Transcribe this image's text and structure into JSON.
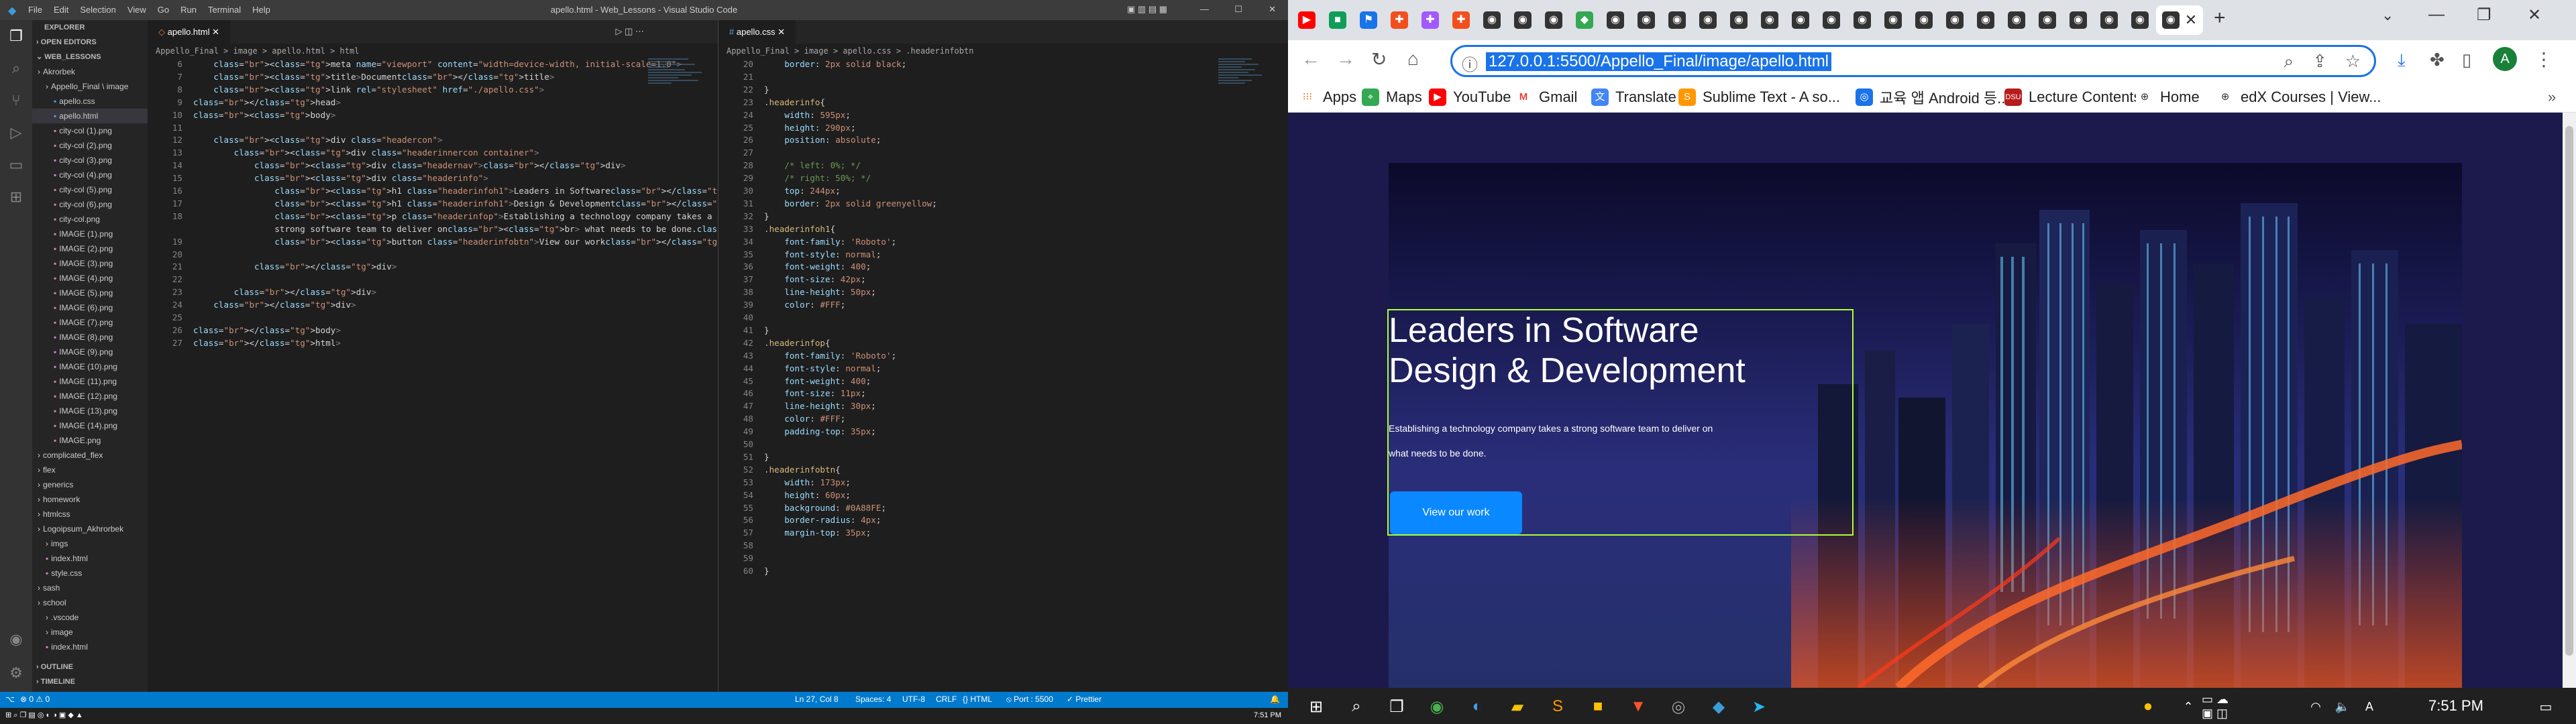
{
  "vscode": {
    "menu": [
      "File",
      "Edit",
      "Selection",
      "View",
      "Go",
      "Run",
      "Terminal",
      "Help"
    ],
    "title": "apello.html - Web_Lessons - Visual Studio Code",
    "explorer": {
      "header": "EXPLORER",
      "open_editors": "OPEN EDITORS",
      "workspace": "WEB_LESSONS",
      "items": [
        "Akrorbek",
        "Appello_Final \\ image",
        "apello.css",
        "apello.html",
        "city-col (1).png",
        "city-col (2).png",
        "city-col (3).png",
        "city-col (4).png",
        "city-col (5).png",
        "city-col (6).png",
        "city-col.png",
        "IMAGE (1).png",
        "IMAGE (2).png",
        "IMAGE (3).png",
        "IMAGE (4).png",
        "IMAGE (5).png",
        "IMAGE (6).png",
        "IMAGE (7).png",
        "IMAGE (8).png",
        "IMAGE (9).png",
        "IMAGE (10).png",
        "IMAGE (11).png",
        "IMAGE (12).png",
        "IMAGE (13).png",
        "IMAGE (14).png",
        "IMAGE.png",
        "complicated_flex",
        "flex",
        "generics",
        "homework",
        "htmlcss",
        "Logoipsum_Akhrorbek",
        "imgs",
        "index.html",
        "style.css",
        "sash",
        "school",
        ".vscode",
        "image",
        "index.html"
      ],
      "outline": "OUTLINE",
      "timeline": "TIMELINE"
    },
    "left_editor": {
      "tab": "apello.html",
      "breadcrumb": "Appello_Final > image > apello.html > html"
    },
    "right_editor": {
      "tab": "apello.css",
      "breadcrumb": "Appello_Final > image > apello.css > .headerinfobtn"
    },
    "left_lines": [
      {
        "n": "6",
        "t": "    <meta name=\"viewport\" content=\"width=device-width, initial-scale=1.0\">"
      },
      {
        "n": "7",
        "t": "    <title>Document</title>"
      },
      {
        "n": "8",
        "t": "    <link rel=\"stylesheet\" href=\"./apello.css\">"
      },
      {
        "n": "9",
        "t": "</head>"
      },
      {
        "n": "10",
        "t": "<body>"
      },
      {
        "n": "11",
        "t": ""
      },
      {
        "n": "12",
        "t": "    <div class=\"headercon\">"
      },
      {
        "n": "13",
        "t": "        <div class=\"headerinnercon container\">"
      },
      {
        "n": "14",
        "t": "            <div class=\"headernav\"></div>"
      },
      {
        "n": "15",
        "t": "            <div class=\"headerinfo\">"
      },
      {
        "n": "16",
        "t": "                <h1 class=\"headerinfoh1\">Leaders in Software</h1>"
      },
      {
        "n": "17",
        "t": "                <h1 class=\"headerinfoh1\">Design & Development</h1>"
      },
      {
        "n": "18",
        "t": "                <p class=\"headerinfop\">Establishing a technology company takes a"
      },
      {
        "n": "",
        "t": "                strong software team to deliver on<br> what needs to be done.</p>"
      },
      {
        "n": "19",
        "t": "                <button class=\"headerinfobtn\">View our work</button>"
      },
      {
        "n": "20",
        "t": ""
      },
      {
        "n": "21",
        "t": "            </div>"
      },
      {
        "n": "22",
        "t": ""
      },
      {
        "n": "23",
        "t": "        </div>"
      },
      {
        "n": "24",
        "t": "    </div>"
      },
      {
        "n": "25",
        "t": ""
      },
      {
        "n": "26",
        "t": "</body>"
      },
      {
        "n": "27",
        "t": "</html>"
      }
    ],
    "right_lines": [
      {
        "n": "20",
        "t": "    border: 2px solid black;"
      },
      {
        "n": "21",
        "t": ""
      },
      {
        "n": "22",
        "t": "}"
      },
      {
        "n": "23",
        "t": ".headerinfo{"
      },
      {
        "n": "24",
        "t": "    width: 595px;"
      },
      {
        "n": "25",
        "t": "    height: 290px;"
      },
      {
        "n": "26",
        "t": "    position: absolute;"
      },
      {
        "n": "27",
        "t": ""
      },
      {
        "n": "28",
        "t": "    /* left: 0%; */"
      },
      {
        "n": "29",
        "t": "    /* right: 50%; */"
      },
      {
        "n": "30",
        "t": "    top: 244px;"
      },
      {
        "n": "31",
        "t": "    border: 2px solid greenyellow;"
      },
      {
        "n": "32",
        "t": "}"
      },
      {
        "n": "33",
        "t": ".headerinfoh1{"
      },
      {
        "n": "34",
        "t": "    font-family: 'Roboto';"
      },
      {
        "n": "35",
        "t": "    font-style: normal;"
      },
      {
        "n": "36",
        "t": "    font-weight: 400;"
      },
      {
        "n": "37",
        "t": "    font-size: 42px;"
      },
      {
        "n": "38",
        "t": "    line-height: 50px;"
      },
      {
        "n": "39",
        "t": "    color: #FFF;"
      },
      {
        "n": "40",
        "t": ""
      },
      {
        "n": "41",
        "t": "}"
      },
      {
        "n": "42",
        "t": ".headerinfop{"
      },
      {
        "n": "43",
        "t": "    font-family: 'Roboto';"
      },
      {
        "n": "44",
        "t": "    font-style: normal;"
      },
      {
        "n": "45",
        "t": "    font-weight: 400;"
      },
      {
        "n": "46",
        "t": "    font-size: 11px;"
      },
      {
        "n": "47",
        "t": "    line-height: 30px;"
      },
      {
        "n": "48",
        "t": "    color: #FFF;"
      },
      {
        "n": "49",
        "t": "    padding-top: 35px;"
      },
      {
        "n": "50",
        "t": ""
      },
      {
        "n": "51",
        "t": "}"
      },
      {
        "n": "52",
        "t": ".headerinfobtn{"
      },
      {
        "n": "53",
        "t": "    width: 173px;"
      },
      {
        "n": "54",
        "t": "    height: 60px;"
      },
      {
        "n": "55",
        "t": "    background: #0A88FE;"
      },
      {
        "n": "56",
        "t": "    border-radius: 4px;"
      },
      {
        "n": "57",
        "t": "    margin-top: 35px;"
      },
      {
        "n": "58",
        "t": ""
      },
      {
        "n": "59",
        "t": ""
      },
      {
        "n": "60",
        "t": "}"
      }
    ],
    "status": {
      "position": "Ln 27, Col 8",
      "spaces": "Spaces: 4",
      "encoding": "UTF-8",
      "eol": "CRLF",
      "lang": "HTML",
      "port": "Port : 5500",
      "prettier": "Prettier"
    },
    "task_time": "7:51 PM"
  },
  "chrome": {
    "url": "127.0.0.1:5500/Appello_Final/image/apello.html",
    "bookmarks": [
      "Apps",
      "Maps",
      "YouTube",
      "Gmail",
      "Translate",
      "Sublime Text - A so...",
      "교육 앱 Android 등...",
      "Lecture Contents",
      "Home",
      "edX Courses | View..."
    ],
    "page": {
      "h1a": "Leaders in Software",
      "h1b": "Design & Development",
      "p": "Establishing a technology company takes a strong software team to deliver on\nwhat needs to be done.",
      "button": "View our work"
    },
    "clock": "7:51 PM"
  }
}
